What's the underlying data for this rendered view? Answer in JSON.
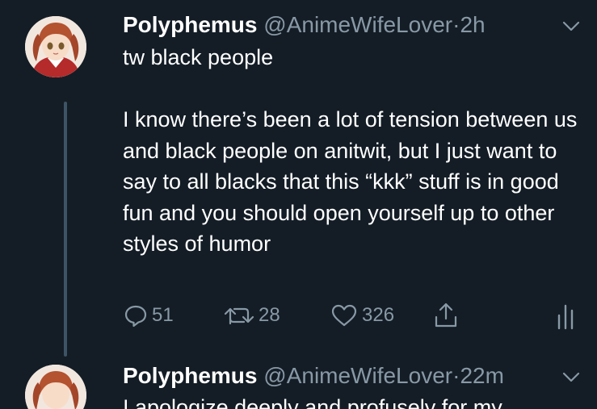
{
  "tweets": [
    {
      "display_name": "Polyphemus",
      "handle": "@AnimeWifeLover",
      "separator": "·",
      "time": "2h",
      "text": "tw black people\n\nI know there’s been a lot of tension between us and black people on anitwit, but I just want to say to all blacks that this “kkk” stuff is in good fun and you should open yourself up to other styles of humor",
      "actions": {
        "replies": "51",
        "retweets": "28",
        "likes": "326"
      }
    },
    {
      "display_name": "Polyphemus",
      "handle": "@AnimeWifeLover",
      "separator": "·",
      "time": "22m",
      "text": "I apologize deeply and profusely for my"
    }
  ],
  "icons": {
    "reply": "reply-icon",
    "retweet": "retweet-icon",
    "like": "heart-icon",
    "share": "share-icon",
    "analytics": "analytics-icon",
    "menu": "chevron-down-icon"
  },
  "colors": {
    "background": "#141d26",
    "text": "#ffffff",
    "secondary": "#8899a6",
    "thread_line": "#3d5466"
  }
}
